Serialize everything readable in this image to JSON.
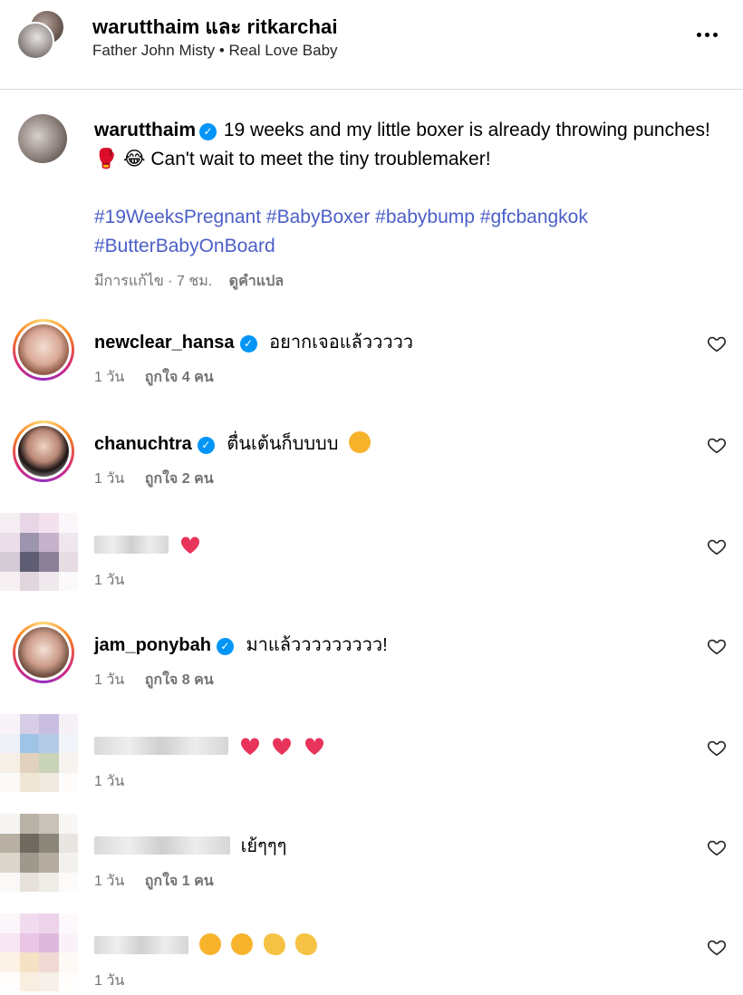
{
  "header": {
    "title": "warutthaim และ ritkarchai",
    "subtitle": "Father John Misty • Real Love Baby"
  },
  "caption": {
    "username": "warutthaim",
    "text": "19 weeks and my little boxer is already throwing punches! 🥊 😂 Can't wait to meet the tiny troublemaker!",
    "hashtags": [
      "#19WeeksPregnant",
      "#BabyBoxer",
      "#babybump",
      "#gfcbangkok",
      "#ButterBabyOnBoard"
    ],
    "meta": "มีการแก้ไข · 7 ชม.",
    "translate_label": "ดูคำแปล"
  },
  "comments": [
    {
      "username": "newclear_hansa",
      "verified": true,
      "text": "อยากเจอแล้ววววว",
      "time": "1 วัน",
      "likes": "ถูกใจ 4 คน"
    },
    {
      "username": "chanuchtra",
      "verified": true,
      "text": "ตื่นเต้นก็บบบบ",
      "time": "1 วัน",
      "likes": "ถูกใจ 2 คน",
      "emoji": "heart-eyes"
    },
    {
      "username": "",
      "verified": false,
      "text": "",
      "time": "1 วัน",
      "likes": "",
      "emoji": "heart"
    },
    {
      "username": "jam_ponybah",
      "verified": true,
      "text": "มาแล้ววววววววว!",
      "time": "1 วัน",
      "likes": "ถูกใจ 8 คน"
    },
    {
      "username": "",
      "verified": false,
      "text": "",
      "time": "1 วัน",
      "likes": "",
      "emoji": "three-hearts"
    },
    {
      "username": "",
      "verified": false,
      "text": "เย้ๆๆๆ",
      "time": "1 วัน",
      "likes": "ถูกใจ 1 คน"
    },
    {
      "username": "",
      "verified": false,
      "text": "",
      "time": "1 วัน",
      "likes": "",
      "emoji": "heart-eyes-x2-clap-x2"
    }
  ],
  "colors": {
    "hashtag": "#4b5fc7",
    "verified": "#0095f6",
    "meta": "#737373",
    "heart_emoji": "#e8345a"
  },
  "icons": {
    "more": "more-horizontal-icon",
    "like": "heart-outline-icon",
    "verified": "verified-badge-icon"
  }
}
